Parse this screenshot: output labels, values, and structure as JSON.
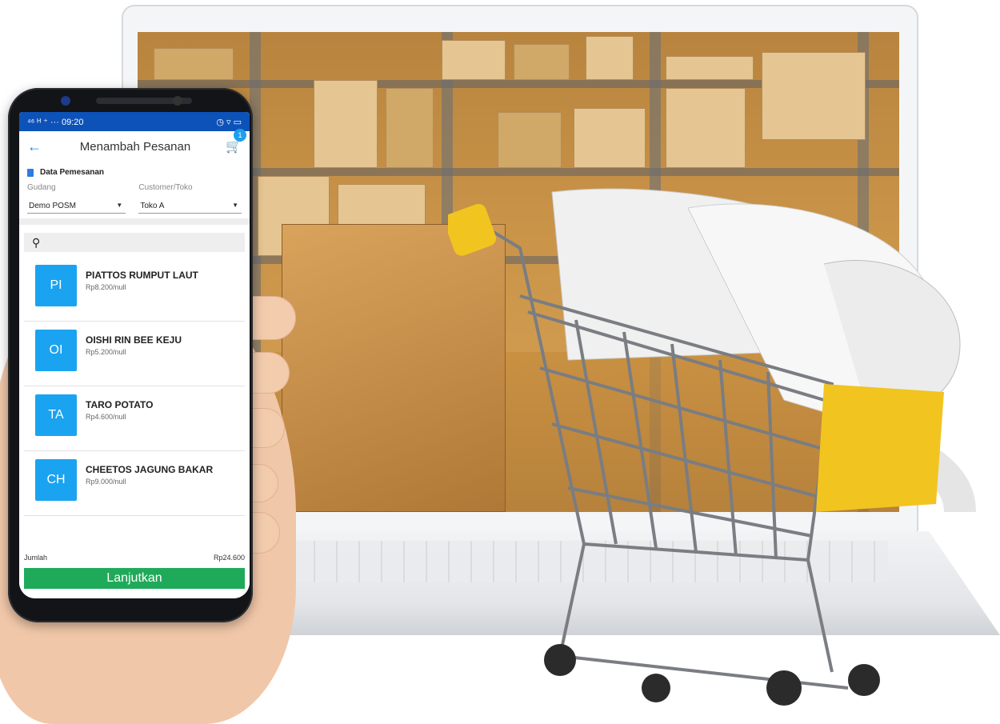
{
  "statusbar": {
    "time": "09:20",
    "left_icons": "⁴⁶ ᴴ ⁺ ··· ",
    "right_icons": "◷ ▿ ▭"
  },
  "appbar": {
    "title": "Menambah Pesanan",
    "back_icon": "arrow-left-icon",
    "cart_icon": "cart-icon",
    "cart_count": "1"
  },
  "order_section": {
    "heading": "Data Pemesanan",
    "warehouse_label": "Gudang",
    "warehouse_value": "Demo POSM",
    "customer_label": "Customer/Toko",
    "customer_value": "Toko A"
  },
  "search": {
    "icon": "search-icon"
  },
  "products": [
    {
      "initials": "PI",
      "name": "PIATTOS RUMPUT LAUT",
      "price": "Rp8.200/null"
    },
    {
      "initials": "OI",
      "name": "OISHI RIN BEE KEJU",
      "price": "Rp5.200/null"
    },
    {
      "initials": "TA",
      "name": "TARO POTATO",
      "price": "Rp4.600/null"
    },
    {
      "initials": "CH",
      "name": "CHEETOS JAGUNG BAKAR",
      "price": "Rp9.000/null"
    }
  ],
  "footer": {
    "total_label": "Jumlah",
    "total_value": "Rp24.600",
    "continue_label": "Lanjutkan"
  },
  "colors": {
    "accent_blue": "#1aa3f0",
    "status_blue": "#0d52b9",
    "continue_green": "#1faa5a"
  }
}
